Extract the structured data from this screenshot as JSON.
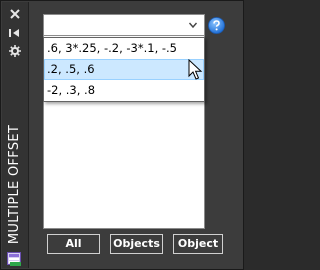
{
  "palette": {
    "title": "MULTIPLE OFFSET",
    "titlebar_icons": [
      "close-icon",
      "auto-hide-icon",
      "properties-icon"
    ]
  },
  "combo": {
    "value": "",
    "options": [
      {
        "label": ".6, 3*.25, -.2, -3*.1, -.5",
        "highlighted": false
      },
      {
        "label": ".2, .5, .6",
        "highlighted": true
      },
      {
        "label": "-2, .3, .8",
        "highlighted": false
      }
    ]
  },
  "buttons": {
    "all": "All",
    "objects": "Objects",
    "object": "Object"
  },
  "colors": {
    "panel_bg": "#3c3c3c",
    "highlight": "#cce8ff",
    "highlight_border": "#99d1ff",
    "help_blue": "#2f7fe0"
  }
}
